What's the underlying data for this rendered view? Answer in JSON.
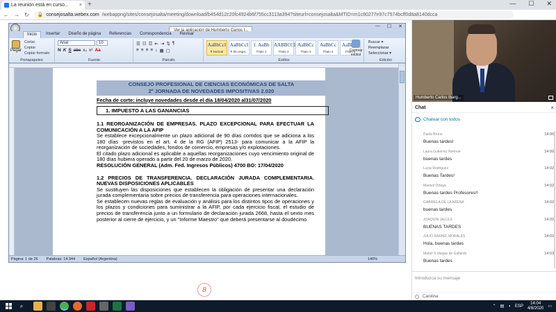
{
  "browser": {
    "tab_title": "La reunión está en curso...",
    "tab_close": "×",
    "new_tab": "+",
    "window_controls": [
      "—",
      "☐",
      "✕"
    ],
    "url_host": "consejosalta.webex.com",
    "url_path": "/webappng/sites/consejosalta/meeting/download/b454d12c20fc4924b6f755cc3113a394?siteurl=consejosalta&MTID=m1c80277e97c7574bcff0d8a8140dcca",
    "nav": [
      "←",
      "→",
      "↻"
    ]
  },
  "word": {
    "window_controls": [
      "—",
      "☐",
      "✕"
    ],
    "tooltip": "Ver la aplicación de Humberto Carlos I...",
    "ribbon_tabs": [
      "Inicio",
      "Insertar",
      "Diseño de página",
      "Referencias",
      "Correspondencia",
      "Revisar"
    ],
    "clipboard": {
      "paste": "Pegar",
      "cut": "Cortar",
      "copy": "Copiar",
      "format_painter": "Copiar formato",
      "label": "Portapapeles"
    },
    "font": {
      "name": "Arial",
      "size": "10",
      "label": "Fuente",
      "format_buttons": [
        "N",
        "K",
        "S",
        "abc",
        "x₂",
        "x²",
        "Aa"
      ]
    },
    "paragraph": {
      "label": "Párrafo"
    },
    "styles": {
      "label": "Estilos",
      "items": [
        {
          "sample": "AaBbCcI",
          "name": "¶ Normal",
          "active": true
        },
        {
          "sample": "AaBbCcI",
          "name": "¶ Sin espa...",
          "active": false
        },
        {
          "sample": "1. AaBb",
          "name": "Título 1",
          "active": false
        },
        {
          "sample": "AABBCCI",
          "name": "Título 2",
          "active": false
        },
        {
          "sample": "AaBbCc",
          "name": "Título 3",
          "active": false
        },
        {
          "sample": "AaBbCc",
          "name": "Título 4",
          "active": false
        },
        {
          "sample": "AaBbCc",
          "name": "Título 5",
          "active": false
        }
      ],
      "change_styles": "Cambiar estilos"
    },
    "editing": {
      "label": "Edición",
      "items": [
        "Buscar ▾",
        "Reemplazar",
        "Seleccionar ▾"
      ]
    },
    "statusbar": {
      "page": "Página: 1 de 26",
      "words": "Palabras: 14.944",
      "language": "Español (Argentina)",
      "zoom": "140%"
    }
  },
  "document": {
    "header_line1": "CONSEJO PROFESIONAL DE CIENCIAS ECONÓMICAS DE SALTA",
    "header_line2": "2º JORNADA DE NOVEDADES IMPOSITIVAS 2.020",
    "fecha": "Fecha de corte: incluye novedades desde el día 18/04/2020 al31/07/2020",
    "section_title": "1.   IMPUESTO A LAS GANANCIAS",
    "h1": "1.1 REORGANIZACIÓN DE EMPRESAS. PLAZO EXCEPCIONAL PARA EFECTUAR LA COMUNICACIÓN A LA AFIP",
    "p1": "Se establece excepcionalmente un plazo adicional de 90 días corridos que se adiciona a los 180 días -previstos en el art. 4 de la RG (AFIP) 2513- para comunicar a la AFIP la reorganización de sociedades, fondos de comercio, empresas y/o explotaciones.",
    "p2": "El citado plazo adicional es aplicable a aquellas reorganizaciones cuyo vencimiento original de 180 días hubiera operado a partir del 20 de marzo de 2020.",
    "resol": "RESOLUCIÓN GENERAL (Adm. Fed. Ingresos Públicos) 4700 BO: 17/04/2020",
    "h2": "1.2 PRECIOS DE TRANSFERENCIA. DECLARACIÓN JURADA COMPLEMENTARIA. NUEVAS DISPOSICIONES APLICABLES",
    "p3": "Se sustituyen las disposiciones que establecen la obligación de presentar una declaración jurada complementaria sobre precios de transferencia para operaciones internacionales.",
    "p4": "Se establecen nuevas reglas de evaluación y análisis para los distintos tipos de operaciones y los plazos y condiciones para suministrar a la AFIP, por cada ejercicio fiscal, el estudio de precios de transferencia junto a un formulario de declaración jurada 2668, hasta el sexto mes posterior al cierre de ejercicio, y un \"Informe Maestro\" que deberá presentarse al doudécimo"
  },
  "video": {
    "participant": "Humberto Carlos Ibarg..."
  },
  "chat": {
    "title": "Chat",
    "close": "×",
    "chat_all": "Chatear con todos",
    "messages": [
      {
        "sender": "Paola Bruno",
        "time": "14:00",
        "text": "Buenas tardes!"
      },
      {
        "sender": "Laura Gutierrez Rennoe",
        "time": "14:00",
        "text": "buenas tardes"
      },
      {
        "sender": "Lucia Rodriguez",
        "time": "14:02",
        "text": "Buenas Tardes!"
      },
      {
        "sender": "Marisol Ortega",
        "time": "14:02",
        "text": "Buenas tardes Profesores!!"
      },
      {
        "sender": "GABRIELA DE LA ARENA",
        "time": "14:02",
        "text": "buenas tardes"
      },
      {
        "sender": "JOAQUIN JALLES",
        "time": "14:02",
        "text": "BUENAS TARDES"
      },
      {
        "sender": "JULIO RAFAEL MORALES",
        "time": "14:02",
        "text": "Hola, buenas tardes"
      },
      {
        "sender": "Mabel S Vargas de Gallardo",
        "time": "14:03",
        "text": "Buenas tardes"
      }
    ],
    "input_placeholder": "Introduzca su mensaje",
    "typing_user": "Carolina"
  },
  "taskbar": {
    "lang": "ESP",
    "time": "14:04",
    "date": "4/8/2020"
  },
  "colors": {
    "webex_accent": "#007aa3",
    "word_header_bg": "#a7b7cf",
    "taskbar_bg": "#0d1b2a"
  }
}
